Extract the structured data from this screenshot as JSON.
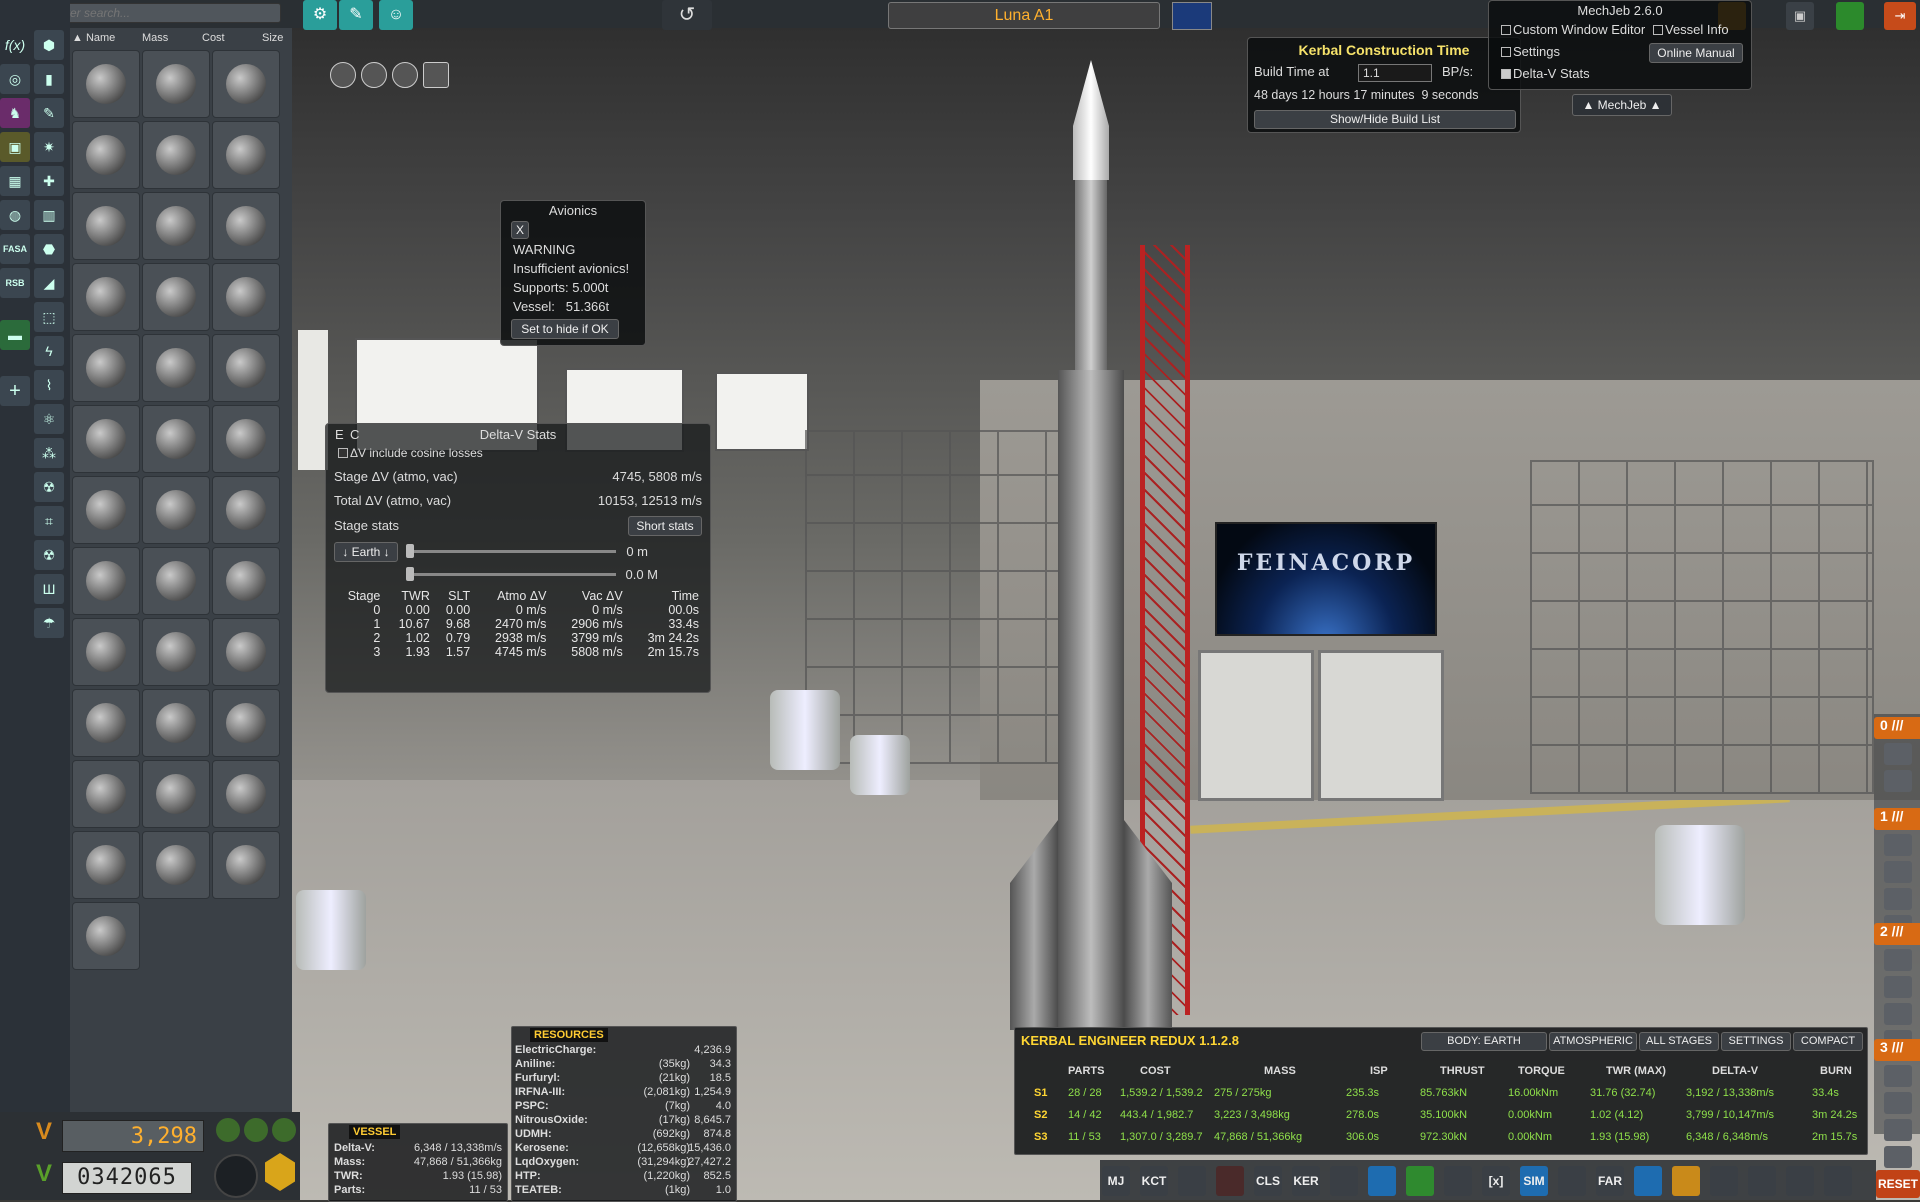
{
  "search": {
    "placeholder": "Enter search..."
  },
  "parts_header": {
    "name": "Name",
    "mass": "Mass",
    "cost": "Cost",
    "size": "Size"
  },
  "vessel_name": "Luna A1",
  "funds": "3,298",
  "science_counter": "0342065",
  "mechjeb": {
    "title": "MechJeb 2.6.0",
    "custom_window_editor": "Custom Window Editor",
    "vessel_info": "Vessel Info",
    "settings": "Settings",
    "online_manual": "Online Manual",
    "delta_v_stats": "Delta-V Stats",
    "toggle_label": "▲ MechJeb ▲"
  },
  "kct": {
    "title": "Kerbal Construction Time",
    "build_time_label": "Build Time at",
    "build_time_value": "1.1",
    "bps_label": "BP/s:",
    "duration": "48 days 12 hours 17 minutes  9 seconds",
    "toggle_list": "Show/Hide Build List"
  },
  "avionics": {
    "title": "Avionics",
    "close": "X",
    "warning": "WARNING",
    "message": "Insufficient avionics!",
    "supports": "Supports: 5.000t",
    "vessel": "Vessel:   51.366t",
    "hide_button": "Set to hide if OK"
  },
  "dv_stats": {
    "corner_e": "E",
    "corner_c": "C",
    "title": "Delta-V Stats",
    "cosine_label": "ΔV include cosine losses",
    "stage_dv_label": "Stage ΔV (atmo, vac)",
    "stage_dv_value": "4745, 5808 m/s",
    "total_dv_label": "Total ΔV (atmo, vac)",
    "total_dv_value": "10153, 12513 m/s",
    "stage_stats_label": "Stage stats",
    "short_stats_button": "Short stats",
    "body_select": "↓ Earth ↓",
    "altitude": "0 m",
    "mach": "0.0 M",
    "columns": [
      "Stage",
      "TWR",
      "SLT",
      "Atmo ΔV",
      "Vac ΔV",
      "Time"
    ],
    "rows": [
      [
        "0",
        "0.00",
        "0.00",
        "0 m/s",
        "0 m/s",
        "00.0s"
      ],
      [
        "1",
        "10.67",
        "9.68",
        "2470 m/s",
        "2906 m/s",
        "33.4s"
      ],
      [
        "2",
        "1.02",
        "0.79",
        "2938 m/s",
        "3799 m/s",
        "3m 24.2s"
      ],
      [
        "3",
        "1.93",
        "1.57",
        "4745 m/s",
        "5808 m/s",
        "2m 15.7s"
      ]
    ]
  },
  "banner": {
    "text": "FEINACORP"
  },
  "resources": {
    "title": "RESOURCES",
    "rows": [
      [
        "ElectricCharge:",
        "",
        "4,236.9"
      ],
      [
        "Aniline:",
        "(35kg)",
        "34.3"
      ],
      [
        "Furfuryl:",
        "(21kg)",
        "18.5"
      ],
      [
        "IRFNA-III:",
        "(2,081kg)",
        "1,254.9"
      ],
      [
        "PSPC:",
        "(7kg)",
        "4.0"
      ],
      [
        "NitrousOxide:",
        "(17kg)",
        "8,645.7"
      ],
      [
        "UDMH:",
        "(692kg)",
        "874.8"
      ],
      [
        "Kerosene:",
        "(12,658kg)",
        "15,436.0"
      ],
      [
        "LqdOxygen:",
        "(31,294kg)",
        "27,427.2"
      ],
      [
        "HTP:",
        "(1,220kg)",
        "852.5"
      ],
      [
        "TEATEB:",
        "(1kg)",
        "1.0"
      ]
    ]
  },
  "vessel": {
    "title": "VESSEL",
    "rows": [
      [
        "Delta-V:",
        "6,348 / 13,338m/s"
      ],
      [
        "Mass:",
        "47,868 / 51,366kg"
      ],
      [
        "TWR:",
        "1.93 (15.98)"
      ],
      [
        "Parts:",
        "11 / 53"
      ]
    ]
  },
  "ker": {
    "title": "KERBAL ENGINEER REDUX 1.1.2.8",
    "buttons": [
      "BODY: EARTH",
      "ATMOSPHERIC",
      "ALL STAGES",
      "SETTINGS",
      "COMPACT"
    ],
    "columns": [
      "PARTS",
      "COST",
      "MASS",
      "ISP",
      "THRUST",
      "TORQUE",
      "TWR (MAX)",
      "DELTA-V",
      "BURN"
    ],
    "rows": [
      [
        "S1",
        "28 / 28",
        "1,539.2 / 1,539.2",
        "275 / 275kg",
        "235.3s",
        "85.763kN",
        "16.00kNm",
        "31.76 (32.74)",
        "3,192 / 13,338m/s",
        "33.4s"
      ],
      [
        "S2",
        "14 / 42",
        "443.4 / 1,982.7",
        "3,223 / 3,498kg",
        "278.0s",
        "35.100kN",
        "0.00kNm",
        "1.02 (4.12)",
        "3,799 / 10,147m/s",
        "3m 24.2s"
      ],
      [
        "S3",
        "11 / 53",
        "1,307.0 / 3,289.7",
        "47,868 / 51,366kg",
        "306.0s",
        "972.30kN",
        "0.00kNm",
        "1.93 (15.98)",
        "6,348 / 6,348m/s",
        "2m 15.7s"
      ]
    ]
  },
  "stages": [
    "0",
    "1",
    "2",
    "3"
  ],
  "toolbar": [
    "MJ",
    "KCT",
    "",
    "",
    "CLS",
    "KER",
    "",
    "",
    "",
    "",
    "[x]",
    "SIM",
    "",
    "FAR",
    "",
    "",
    "",
    "",
    "",
    ""
  ],
  "reset": "RESET",
  "category_icons": [
    "f(x)",
    "tag-icon",
    "pods",
    "fuel",
    "engine",
    "control",
    "structure",
    "aero",
    "utility",
    "science",
    "FASA",
    "RSB"
  ]
}
